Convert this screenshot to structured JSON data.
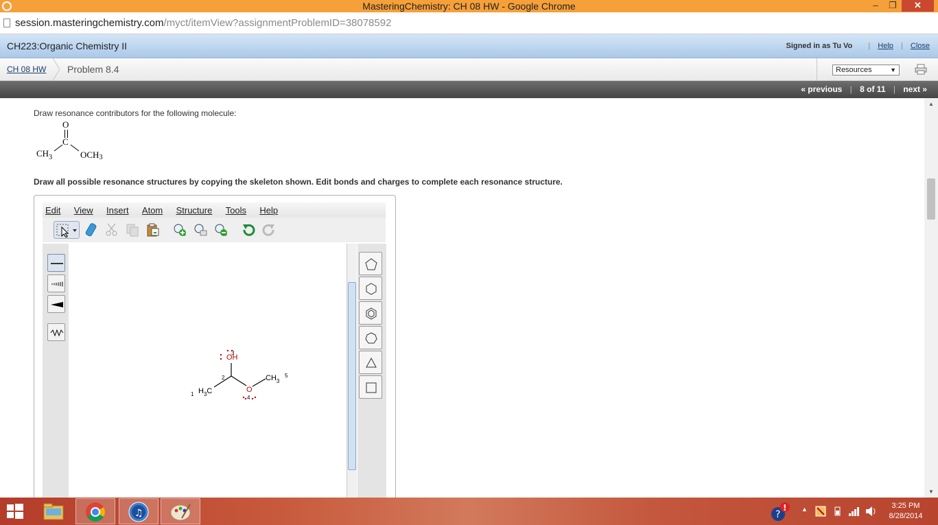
{
  "window": {
    "title": "MasteringChemistry: CH 08 HW - Google Chrome",
    "minimize": "–",
    "maximize": "❐",
    "close": "✕"
  },
  "address": {
    "host": "session.masteringchemistry.com",
    "path": "/myct/itemView?assignmentProblemID=38078592"
  },
  "course_header": {
    "course": "CH223:Organic Chemistry II",
    "signed_in": "Signed in as Tu Vo",
    "help": "Help",
    "close": "Close"
  },
  "breadcrumb": {
    "assignment": "CH 08 HW",
    "problem": "Problem 8.4",
    "resources": "Resources"
  },
  "navigation": {
    "previous": "« previous",
    "position": "8 of 11",
    "next": "next »"
  },
  "question": {
    "prompt": "Draw resonance contributors for the following molecule:",
    "instruction": "Draw all possible resonance structures by copying the skeleton shown. Edit bonds and charges to complete each resonance structure.",
    "molecule_labels": {
      "o": "O",
      "c": "C",
      "ch3": "CH",
      "och3": "OCH",
      "sub3": "3"
    }
  },
  "editor": {
    "menu": [
      "Edit",
      "View",
      "Insert",
      "Atom",
      "Structure",
      "Tools",
      "Help"
    ],
    "toolbar_icons": [
      "select-icon",
      "eraser-icon",
      "cut-icon",
      "copy-icon",
      "paste-icon",
      "zoom-in-icon",
      "zoom-all-icon",
      "zoom-out-icon",
      "undo-icon",
      "redo-icon"
    ],
    "bond_tools": [
      "single-bond-icon",
      "hashed-bond-icon",
      "wedge-bond-icon",
      "wavy-bond-icon"
    ],
    "ring_tools": [
      "cyclopentane-icon",
      "cyclohexane-icon",
      "benzene-icon",
      "cycloheptane-icon",
      "cyclopropane-icon",
      "cyclobutane-icon"
    ],
    "structure": {
      "atoms": [
        {
          "label": "OH",
          "number": "3",
          "color": "#cc0000"
        },
        {
          "label": "",
          "number": "2",
          "color": "#000000"
        },
        {
          "label": "H",
          "sub": "3",
          "tail": "C",
          "number": "1",
          "color": "#000000"
        },
        {
          "label": "O",
          "number": "4",
          "color": "#cc0000"
        },
        {
          "label": "CH",
          "sub": "3",
          "number": "5",
          "color": "#000000"
        }
      ]
    }
  },
  "taskbar": {
    "apps": [
      "file-explorer-icon",
      "chrome-icon",
      "itunes-icon",
      "paint-icon"
    ],
    "time": "3:25 PM",
    "date": "8/28/2014"
  },
  "colors": {
    "titlebar": "#f6a03a",
    "course_bar": "#aac8e8",
    "nav_bar": "#454545",
    "accent_red": "#cc0000"
  }
}
